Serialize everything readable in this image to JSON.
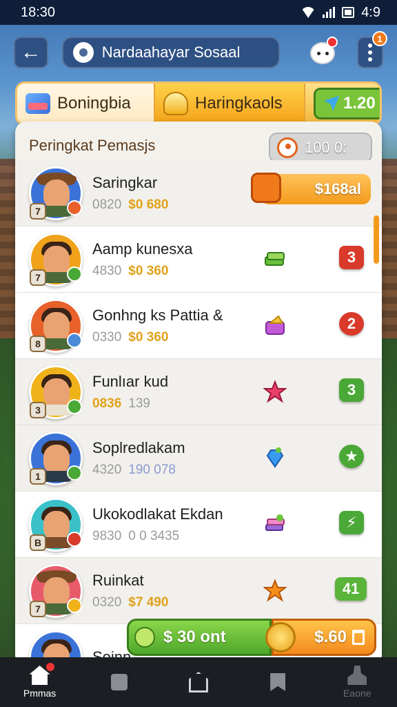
{
  "status_bar": {
    "time": "18:30",
    "battery": "4:9"
  },
  "header": {
    "title": "Nardaahayar Sosaal",
    "more_badge": "1"
  },
  "tabs": [
    {
      "label": "Boningbia"
    },
    {
      "label": "Haringkaols"
    },
    {
      "label": "1.20"
    }
  ],
  "panel": {
    "title": "Peringkat Pemasjs",
    "score": "100 0:"
  },
  "players": [
    {
      "rank": "7",
      "name": "Saringkar",
      "stat1": "0820",
      "stat2": "$0 680",
      "reward": "$168al",
      "avatar_color": "#3a72d8",
      "status_color": "#e8602a"
    },
    {
      "rank": "7",
      "name": "Aamp kunesxa",
      "stat1": "4830",
      "stat2": "$0 360",
      "badge": "3",
      "badge_style": "red",
      "item": "cash-stack-icon",
      "avatar_color": "#f0a21a",
      "status_color": "#4aa836"
    },
    {
      "rank": "8",
      "name": "Gonhng ks Pattia &",
      "stat1": "0330",
      "stat2": "$0 360",
      "badge": "2",
      "badge_style": "red-round",
      "item": "cheese-box-icon",
      "avatar_color": "#e8602a",
      "status_color": "#4a8ad8"
    },
    {
      "rank": "3",
      "name": "Funlıar kud",
      "stat1": "0836",
      "stat2": "139",
      "badge": "3",
      "badge_style": "green",
      "item": "star-berry-icon",
      "avatar_color": "#f0b21a",
      "status_color": "#4aa836"
    },
    {
      "rank": "1",
      "name": "Soplredlakam",
      "stat1": "4320",
      "stat2": "190 078",
      "badge": "★",
      "badge_style": "green-round",
      "item": "blue-gem-icon",
      "avatar_color": "#3a72d8",
      "status_color": "#4aa836"
    },
    {
      "rank": "B",
      "name": "Ukokodlakat Ekdan",
      "stat1": "9830",
      "stat2": "0 0 3435",
      "badge": "⚡",
      "badge_style": "green",
      "item": "book-stack-icon",
      "avatar_color": "#3ac0c8",
      "status_color": "#d93a2a"
    },
    {
      "rank": "7",
      "name": "Ruinkat",
      "stat1": "0320",
      "stat2": "$7 490",
      "badge": "41",
      "badge_style": "green-wide",
      "item": "orange-star-icon",
      "avatar_color": "#e85a6a",
      "status_color": "#f0b21a"
    },
    {
      "rank": "",
      "name": "Soinn",
      "stat1": "",
      "stat2": "",
      "avatar_color": "#3a72d8",
      "status_color": "#4aa836"
    }
  ],
  "actions": {
    "green_label": "$ 30 ont",
    "orange_label": "$.60"
  },
  "bottom_nav": [
    {
      "label": "Pmmas"
    },
    {
      "label": ""
    },
    {
      "label": ""
    },
    {
      "label": ""
    },
    {
      "label": "Eaone"
    }
  ]
}
